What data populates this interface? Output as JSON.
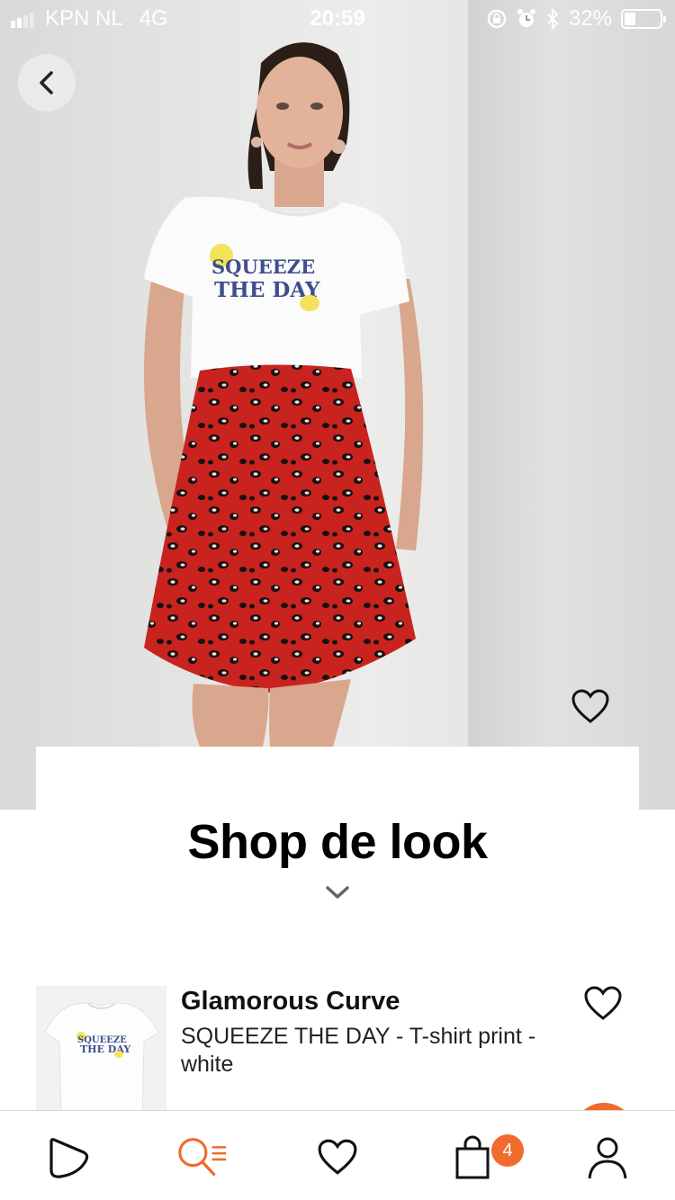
{
  "status_bar": {
    "carrier": "KPN NL",
    "network": "4G",
    "time": "20:59",
    "battery": "32%",
    "battery_level": 0.32
  },
  "photo": {
    "shirt_print_line1": "SQUEEZE",
    "shirt_print_line2": "THE DAY"
  },
  "section": {
    "title": "Shop de look"
  },
  "product": {
    "brand": "Glamorous Curve",
    "name": "SQUEEZE THE DAY  - T-shirt print - white",
    "thumb_print_line1": "SQUEEZE",
    "thumb_print_line2": "THE DAY"
  },
  "bottom_nav": {
    "cart_count": "4",
    "items": [
      "home-icon",
      "search-icon",
      "wishlist-icon",
      "cart-icon",
      "profile-icon"
    ]
  },
  "colors": {
    "accent": "#ef6b2e",
    "skirt_red": "#c8231f",
    "print_navy": "#3e4f8a",
    "lemon": "#f2e35a"
  }
}
